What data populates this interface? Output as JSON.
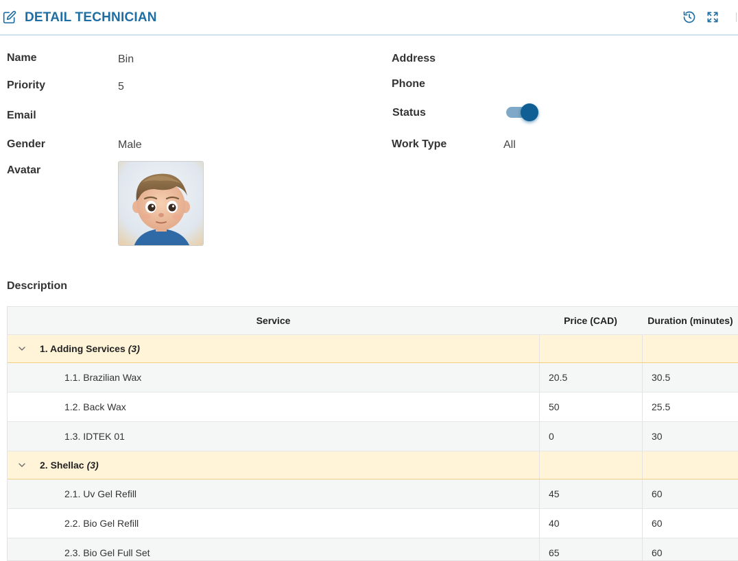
{
  "header": {
    "title": "DETAIL TECHNICIAN",
    "title_icon": "edit-icon",
    "actions": [
      "history-icon",
      "expand-icon"
    ]
  },
  "fields": {
    "name": {
      "label": "Name",
      "value": "Bin"
    },
    "priority": {
      "label": "Priority",
      "value": "5"
    },
    "email": {
      "label": "Email",
      "value": ""
    },
    "gender": {
      "label": "Gender",
      "value": "Male"
    },
    "avatar": {
      "label": "Avatar"
    },
    "address": {
      "label": "Address",
      "value": ""
    },
    "phone": {
      "label": "Phone",
      "value": ""
    },
    "status": {
      "label": "Status",
      "on": true
    },
    "work_type": {
      "label": "Work Type",
      "value": "All"
    }
  },
  "description_label": "Description",
  "table": {
    "headers": {
      "service": "Service",
      "price": "Price (CAD)",
      "duration": "Duration (minutes)"
    },
    "groups": [
      {
        "label": "1. Adding Services",
        "count": "(3)",
        "items": [
          {
            "service": "1.1. Brazilian Wax",
            "price": "20.5",
            "duration": "30.5"
          },
          {
            "service": "1.2. Back Wax",
            "price": "50",
            "duration": "25.5"
          },
          {
            "service": "1.3. IDTEK 01",
            "price": "0",
            "duration": "30"
          }
        ]
      },
      {
        "label": "2. Shellac",
        "count": "(3)",
        "items": [
          {
            "service": "2.1. Uv Gel Refill",
            "price": "45",
            "duration": "60"
          },
          {
            "service": "2.2. Bio Gel Refill",
            "price": "40",
            "duration": "60"
          },
          {
            "service": "2.3. Bio Gel Full Set",
            "price": "65",
            "duration": "60"
          }
        ]
      }
    ]
  },
  "colors": {
    "accent": "#1f6ea3",
    "toggle_on": "#0f5f94",
    "group_row": "#fff4d8"
  }
}
